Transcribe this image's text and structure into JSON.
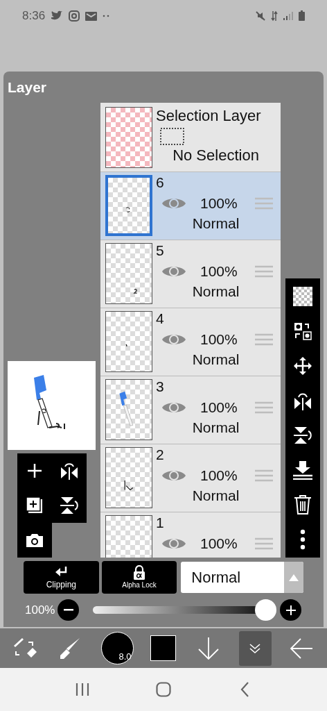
{
  "status_bar": {
    "time": "8:36"
  },
  "panel": {
    "title": "Layer"
  },
  "selection_layer": {
    "title": "Selection Layer",
    "status": "No Selection"
  },
  "layers": [
    {
      "name": "6",
      "visible": true,
      "opacity": "100%",
      "blend": "Normal",
      "selected": true
    },
    {
      "name": "5",
      "visible": true,
      "opacity": "100%",
      "blend": "Normal",
      "selected": false
    },
    {
      "name": "4",
      "visible": true,
      "opacity": "100%",
      "blend": "Normal",
      "selected": false
    },
    {
      "name": "3",
      "visible": true,
      "opacity": "100%",
      "blend": "Normal",
      "selected": false
    },
    {
      "name": "2",
      "visible": true,
      "opacity": "100%",
      "blend": "Normal",
      "selected": false
    },
    {
      "name": "1",
      "visible": true,
      "opacity": "100%",
      "selected": false
    }
  ],
  "controls": {
    "clipping": "Clipping",
    "alpha_lock": "Alpha Lock",
    "blend_mode": "Normal",
    "opacity_label": "100%",
    "opacity": {
      "level": 1.0
    }
  },
  "toolbar": {
    "brush_size": "8.0"
  }
}
